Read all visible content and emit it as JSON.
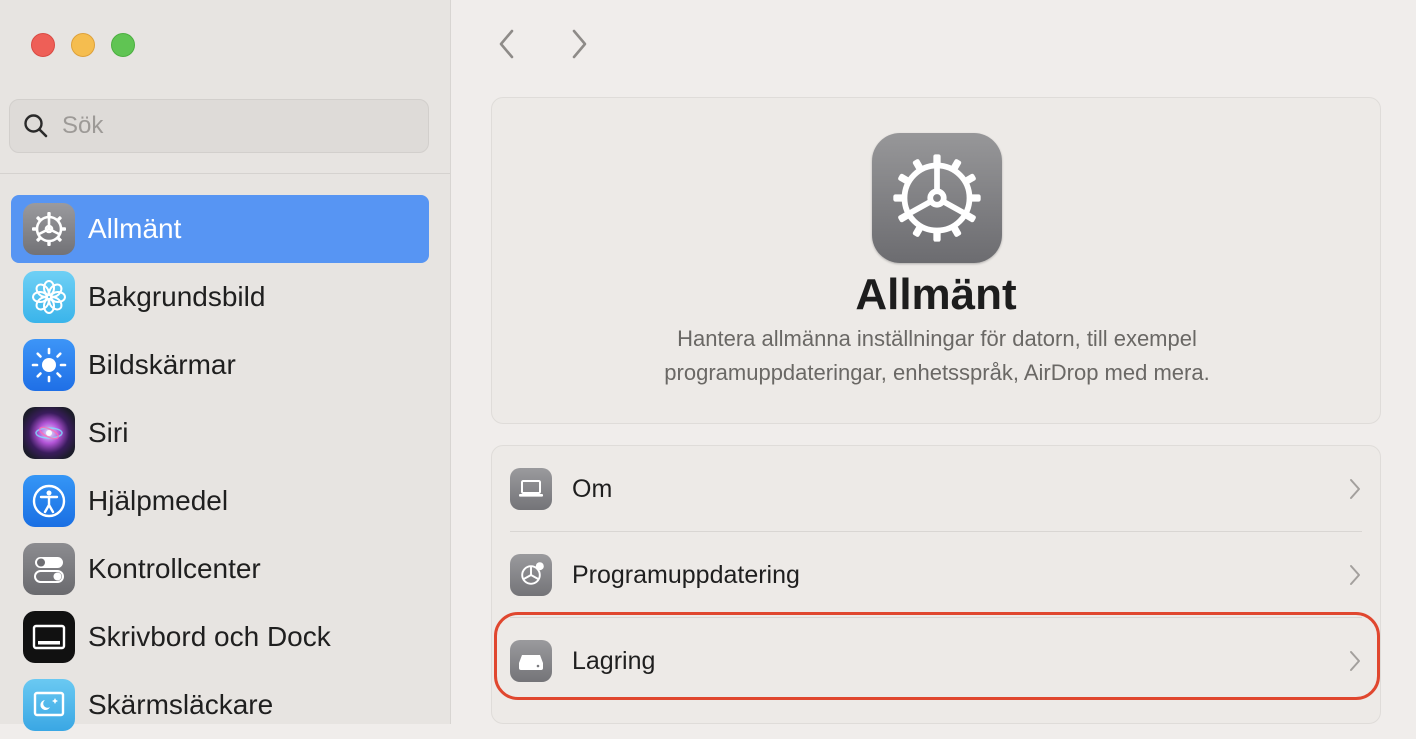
{
  "window": {
    "controls": [
      "close",
      "minimize",
      "maximize"
    ]
  },
  "search": {
    "placeholder": "Sök"
  },
  "sidebar": {
    "items": [
      {
        "label": "Allmänt",
        "icon": "gear-icon",
        "active": true
      },
      {
        "label": "Bakgrundsbild",
        "icon": "flower-icon"
      },
      {
        "label": "Bildskärmar",
        "icon": "sun-icon"
      },
      {
        "label": "Siri",
        "icon": "siri-icon"
      },
      {
        "label": "Hjälpmedel",
        "icon": "accessibility-icon"
      },
      {
        "label": "Kontrollcenter",
        "icon": "toggles-icon"
      },
      {
        "label": "Skrivbord och Dock",
        "icon": "dock-icon"
      },
      {
        "label": "Skärmsläckare",
        "icon": "screensaver-icon"
      }
    ]
  },
  "main": {
    "title": "Allmänt",
    "description_line1": "Hantera allmänna inställningar för datorn, till exempel",
    "description_line2": "programuppdateringar, enhetsspråk, AirDrop med mera.",
    "rows": [
      {
        "label": "Om",
        "icon": "laptop-icon"
      },
      {
        "label": "Programuppdatering",
        "icon": "gear-badge-icon"
      },
      {
        "label": "Lagring",
        "icon": "drive-icon",
        "highlighted": true
      }
    ]
  },
  "colors": {
    "accent": "#5795f3",
    "highlight": "#e0472f"
  }
}
